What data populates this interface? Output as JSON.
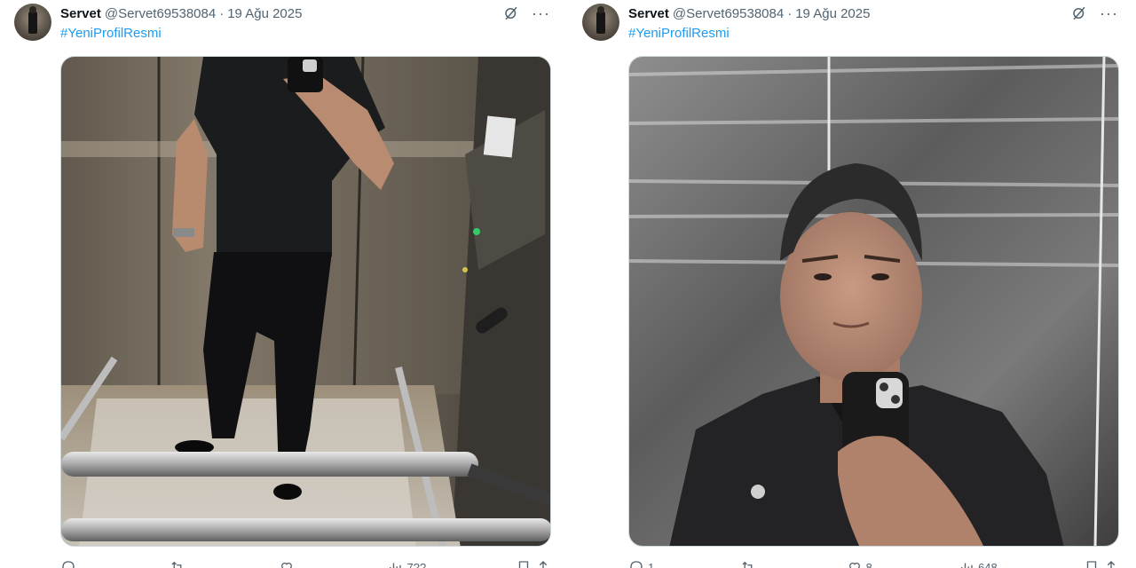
{
  "tweets": [
    {
      "author": {
        "name": "Servet",
        "handle": "@Servet69538084"
      },
      "separator": "·",
      "date": "19 Ağu 2025",
      "hashtag": "#YeniProfilResmi",
      "media": {
        "description_icon": "photo"
      },
      "actions": {
        "reply": "",
        "repost": "",
        "like": "",
        "views": "7??"
      }
    },
    {
      "author": {
        "name": "Servet",
        "handle": "@Servet69538084"
      },
      "separator": "·",
      "date": "19 Ağu 2025",
      "hashtag": "#YeniProfilResmi",
      "media": {
        "description_icon": "photo"
      },
      "actions": {
        "reply": "1",
        "repost": "",
        "like": "8",
        "views": "648"
      }
    }
  ],
  "icons": {
    "grok": "grok-icon",
    "more": "more-icon",
    "reply": "reply-icon",
    "repost": "repost-icon",
    "like": "like-icon",
    "views": "views-icon",
    "bookmark": "bookmark-icon",
    "share": "share-icon"
  },
  "colors": {
    "link": "#1d9bf0",
    "muted": "#536471",
    "text": "#0f1419"
  }
}
